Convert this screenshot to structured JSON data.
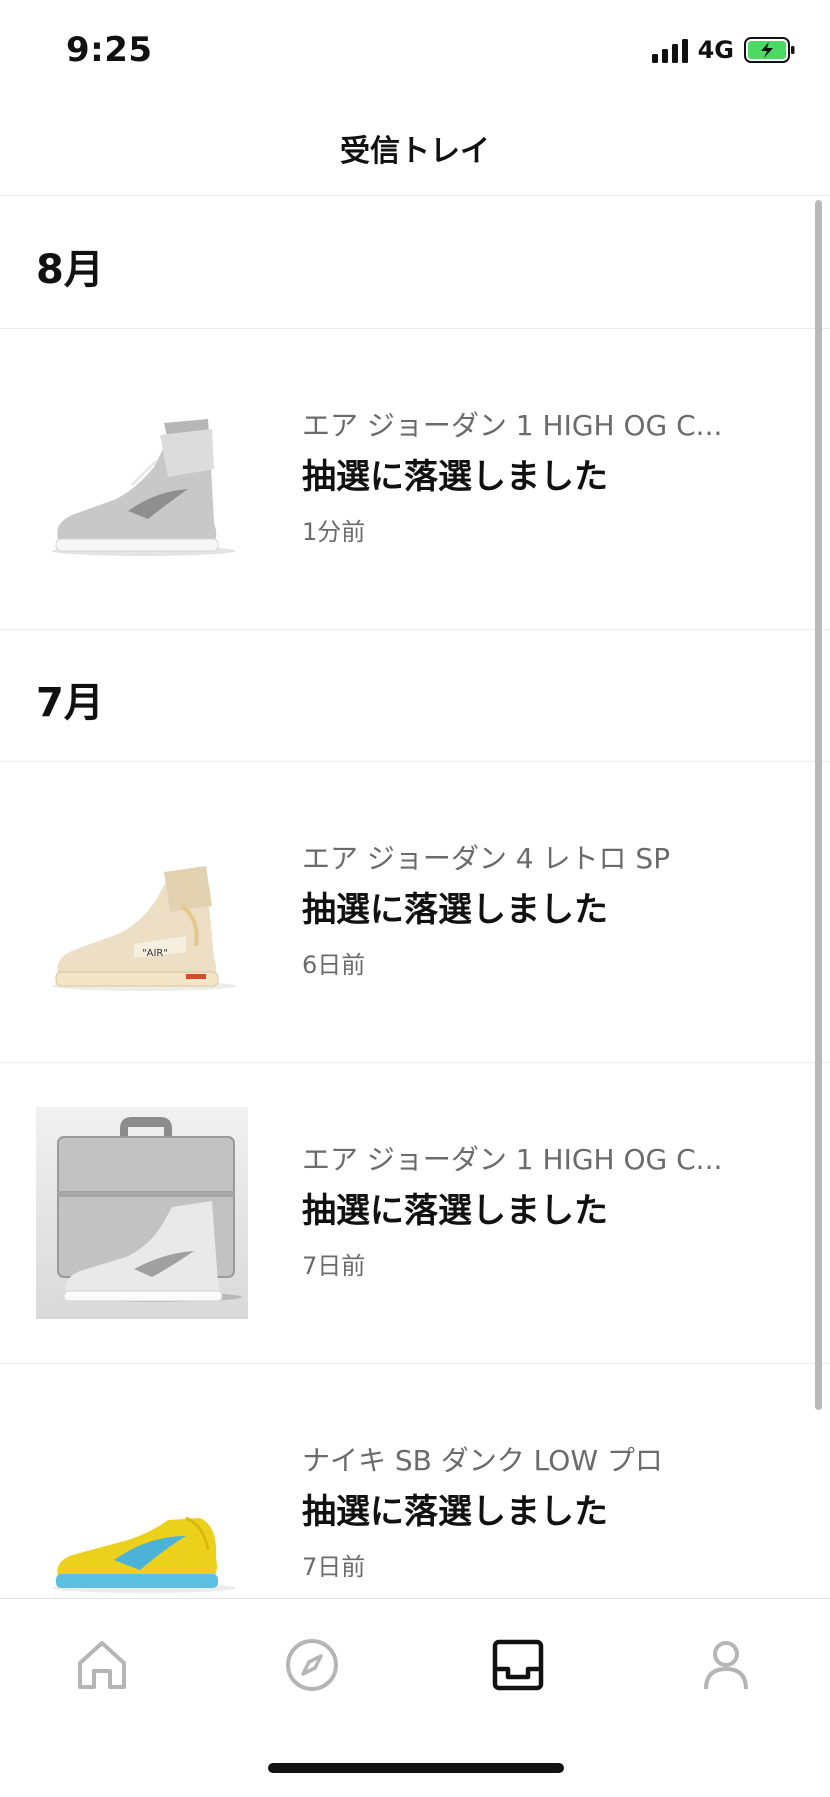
{
  "status_bar": {
    "time": "9:25",
    "network": "4G",
    "icons": [
      "signal-icon",
      "battery-charging-icon"
    ],
    "battery_color": "#4cd964"
  },
  "header": {
    "title": "受信トレイ"
  },
  "sections": [
    {
      "label": "8月",
      "items": [
        {
          "product": "エア ジョーダン 1 HIGH OG C...",
          "title": "抽選に落選しました",
          "time": "1分前",
          "image": "sneaker-silver"
        }
      ]
    },
    {
      "label": "7月",
      "items": [
        {
          "product": "エア ジョーダン 4 レトロ SP",
          "title": "抽選に落選しました",
          "time": "6日前",
          "image": "sneaker-sail"
        },
        {
          "product": "エア ジョーダン 1 HIGH OG C...",
          "title": "抽選に落選しました",
          "time": "7日前",
          "image": "sneaker-silver-case"
        },
        {
          "product": "ナイキ SB ダンク LOW プロ",
          "title": "抽選に落選しました",
          "time": "7日前",
          "image": "sneaker-yellow"
        }
      ]
    }
  ],
  "tab_bar": {
    "tabs": [
      {
        "name": "home",
        "icon": "home-icon",
        "active": false
      },
      {
        "name": "discover",
        "icon": "compass-icon",
        "active": false
      },
      {
        "name": "inbox",
        "icon": "inbox-icon",
        "active": true
      },
      {
        "name": "profile",
        "icon": "person-icon",
        "active": false
      }
    ],
    "active_color": "#111111",
    "inactive_color": "#b5b5b5"
  }
}
